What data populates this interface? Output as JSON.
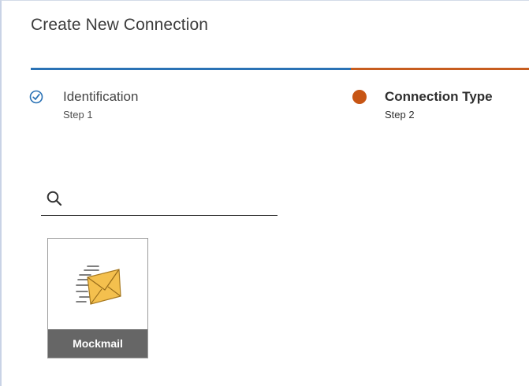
{
  "dialog": {
    "title": "Create New Connection"
  },
  "steps": [
    {
      "name": "Identification",
      "sub": "Step 1",
      "state": "completed"
    },
    {
      "name": "Connection Type",
      "sub": "Step 2",
      "state": "active"
    }
  ],
  "search": {
    "value": "",
    "placeholder": "",
    "icon": "search-icon"
  },
  "connection_types": [
    {
      "label": "Mockmail",
      "icon": "mail-envelope-icon"
    }
  ],
  "colors": {
    "completed": "#2a72b5",
    "active": "#c75514",
    "tile_label_bg": "#666666",
    "envelope": "#f2bc4a"
  }
}
